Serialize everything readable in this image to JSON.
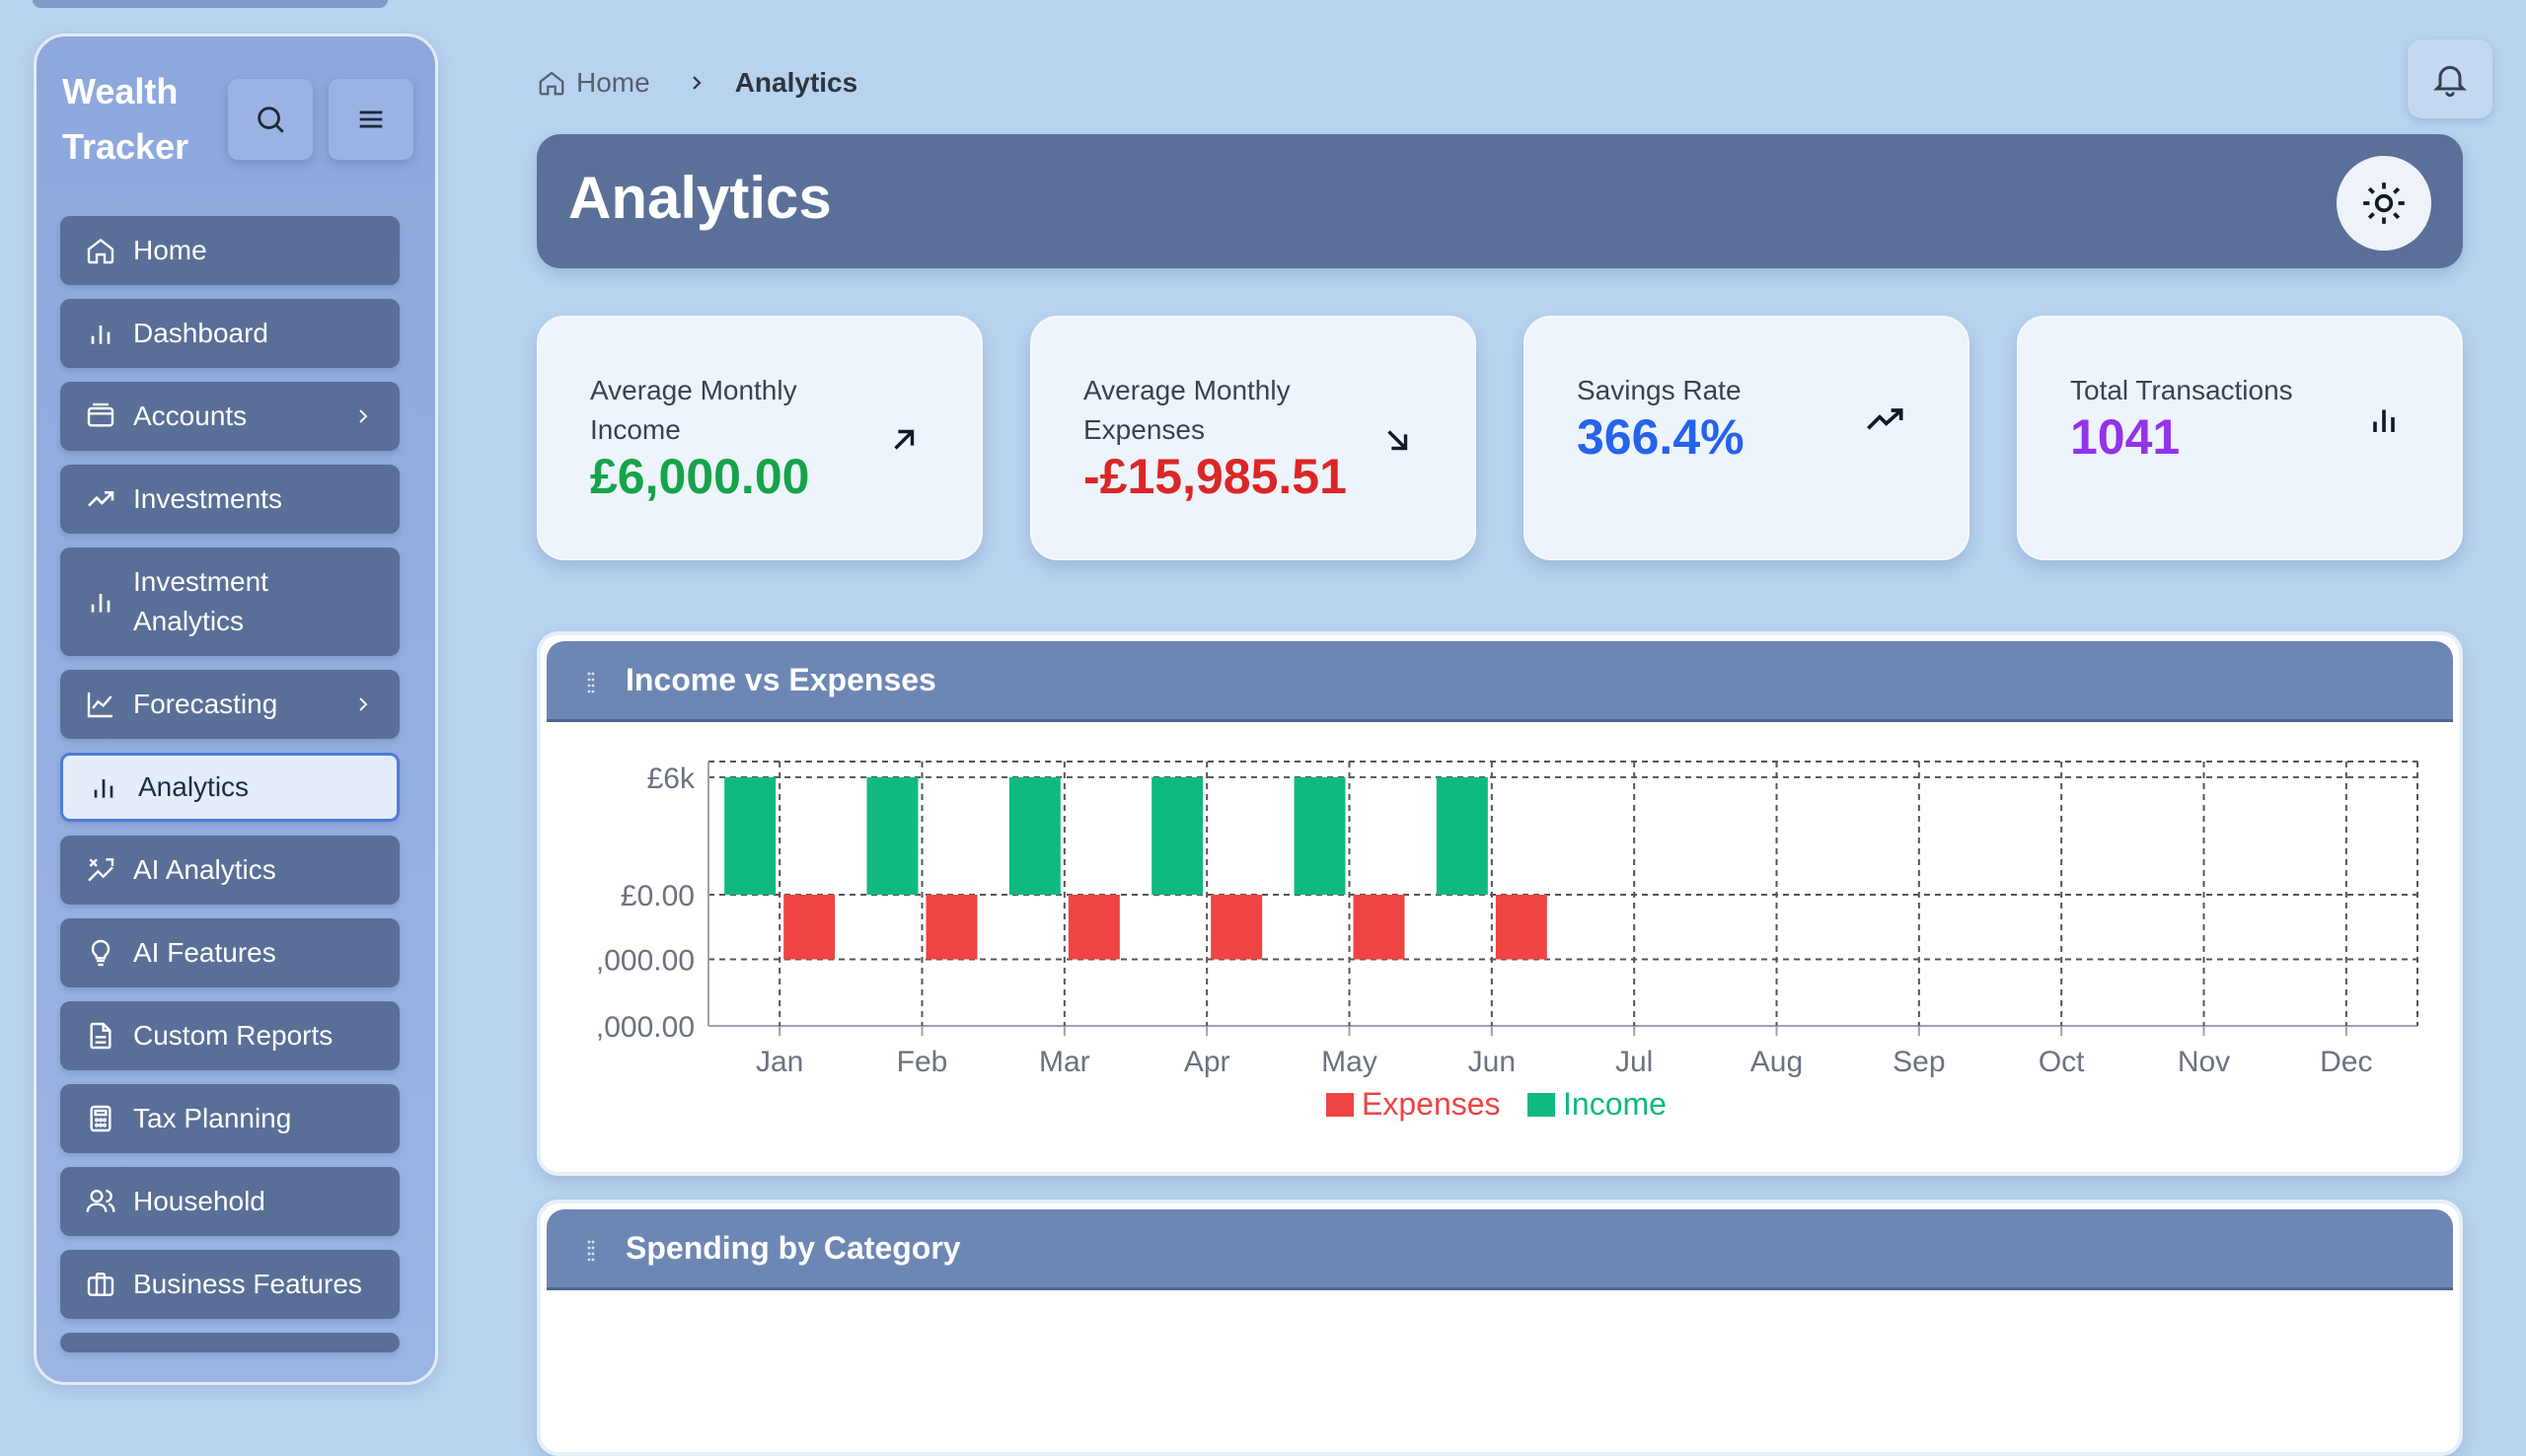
{
  "brand": {
    "title_line1": "Wealth",
    "title_line2": "Tracker"
  },
  "sidebar": {
    "items": [
      {
        "label": "Home",
        "icon": "home-icon"
      },
      {
        "label": "Dashboard",
        "icon": "bar-chart-icon"
      },
      {
        "label": "Accounts",
        "icon": "wallet-icon",
        "has_submenu": true
      },
      {
        "label": "Investments",
        "icon": "trending-up-icon"
      },
      {
        "label": "Investment Analytics",
        "icon": "bar-chart-icon"
      },
      {
        "label": "Forecasting",
        "icon": "line-chart-icon",
        "has_submenu": true
      },
      {
        "label": "Analytics",
        "icon": "bar-chart-icon",
        "active": true
      },
      {
        "label": "AI Analytics",
        "icon": "ai-sparkle-icon"
      },
      {
        "label": "AI Features",
        "icon": "lightbulb-icon"
      },
      {
        "label": "Custom Reports",
        "icon": "document-icon"
      },
      {
        "label": "Tax Planning",
        "icon": "calculator-icon"
      },
      {
        "label": "Household",
        "icon": "users-icon"
      },
      {
        "label": "Business Features",
        "icon": "briefcase-icon"
      }
    ]
  },
  "breadcrumb": {
    "home": "Home",
    "current": "Analytics"
  },
  "header": {
    "title": "Analytics"
  },
  "kpis": [
    {
      "label": "Average Monthly Income",
      "value": "£6,000.00",
      "color": "#16a34a",
      "icon": "arrow-up-right-icon"
    },
    {
      "label": "Average Monthly Expenses",
      "value": "-£15,985.51",
      "color": "#dc2626",
      "icon": "arrow-down-right-icon"
    },
    {
      "label": "Savings Rate",
      "value": "366.4%",
      "color": "#2563eb",
      "icon": "trending-up-icon"
    },
    {
      "label": "Total Transactions",
      "value": "1041",
      "color": "#9333ea",
      "icon": "bar-chart-icon"
    }
  ],
  "panels": {
    "income_vs_expenses": {
      "title": "Income vs Expenses"
    },
    "spending_by_category": {
      "title": "Spending by Category"
    }
  },
  "colors": {
    "income": "#10b981",
    "expenses": "#ef4444",
    "accent": "#5b7098"
  },
  "chart_data": {
    "type": "bar",
    "categories": [
      "Jan",
      "Feb",
      "Mar",
      "Apr",
      "May",
      "Jun",
      "Jul",
      "Aug",
      "Sep",
      "Oct",
      "Nov",
      "Dec"
    ],
    "series": [
      {
        "name": "Expenses",
        "values": [
          -3300,
          -3300,
          -3300,
          -3300,
          -3300,
          -3300,
          null,
          null,
          null,
          null,
          null,
          null
        ]
      },
      {
        "name": "Income",
        "values": [
          6000,
          6000,
          6000,
          6000,
          6000,
          6000,
          null,
          null,
          null,
          null,
          null,
          null
        ]
      }
    ],
    "y_tick_labels": [
      "£6k",
      "£0.00",
      ",000.00",
      ",000.00"
    ],
    "ylim": [
      -6700,
      6800
    ],
    "grid": true,
    "legend": "bottom-center"
  }
}
